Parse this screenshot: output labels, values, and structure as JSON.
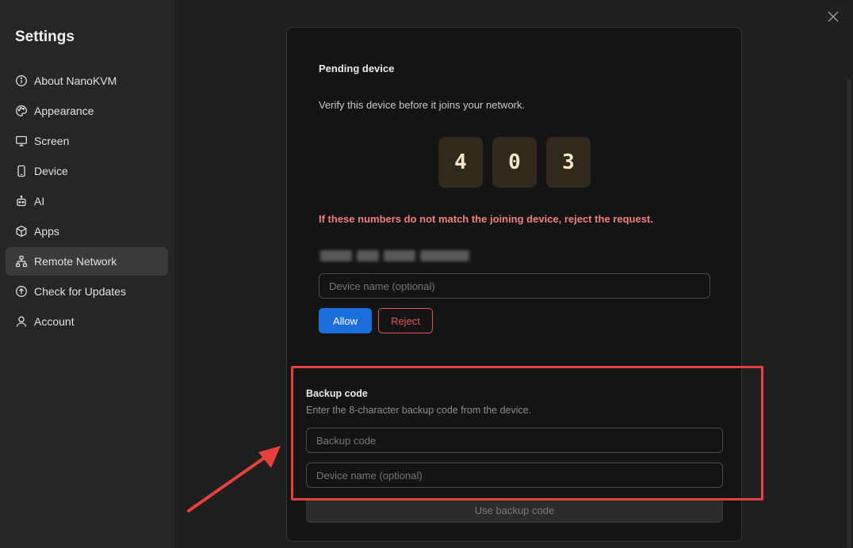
{
  "sidebar": {
    "title": "Settings",
    "items": [
      {
        "label": "About NanoKVM",
        "icon": "info-icon"
      },
      {
        "label": "Appearance",
        "icon": "palette-icon"
      },
      {
        "label": "Screen",
        "icon": "monitor-icon"
      },
      {
        "label": "Device",
        "icon": "phone-icon"
      },
      {
        "label": "AI",
        "icon": "robot-icon"
      },
      {
        "label": "Apps",
        "icon": "box-icon"
      },
      {
        "label": "Remote Network",
        "icon": "network-icon",
        "active": true
      },
      {
        "label": "Check for Updates",
        "icon": "upload-circle-icon"
      },
      {
        "label": "Account",
        "icon": "user-icon"
      }
    ]
  },
  "pending": {
    "title": "Pending device",
    "description": "Verify this device before it joins your network.",
    "digits": [
      "4",
      "0",
      "3"
    ],
    "warning": "If these numbers do not match the joining device, reject the request.",
    "device_name_placeholder": "Device name (optional)",
    "allow_label": "Allow",
    "reject_label": "Reject"
  },
  "backup": {
    "title": "Backup code",
    "description": "Enter the 8-character backup code from the device.",
    "code_placeholder": "Backup code",
    "device_name_placeholder": "Device name (optional)",
    "use_label": "Use backup code"
  },
  "colors": {
    "accent": "#1a6fdd",
    "danger": "#e05656",
    "warning_text": "#f08080",
    "annotation": "#e8403f"
  }
}
